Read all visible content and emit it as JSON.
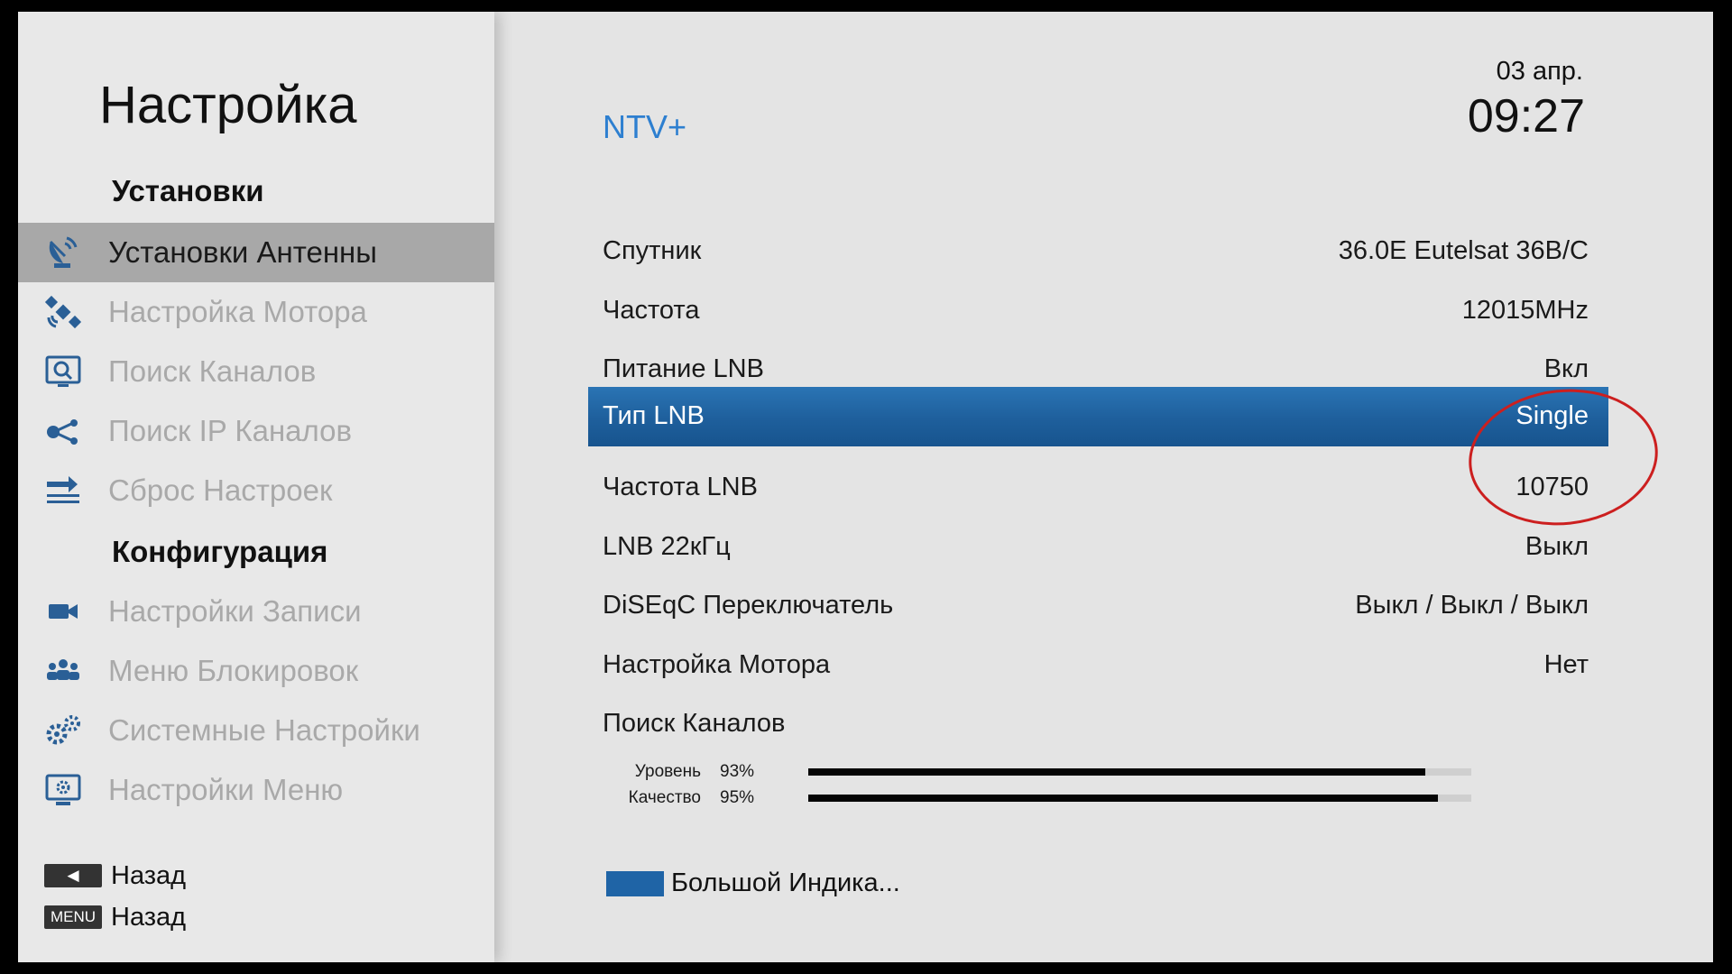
{
  "sidebar": {
    "title": "Настройка",
    "sections": [
      {
        "heading": "Установки",
        "items": [
          {
            "label": "Установки Антенны",
            "icon": "satellite-dish-icon",
            "active": true
          },
          {
            "label": "Настройка Мотора",
            "icon": "satellite-icon",
            "active": false
          },
          {
            "label": "Поиск Каналов",
            "icon": "channel-search-icon",
            "active": false
          },
          {
            "label": "Поиск IP Каналов",
            "icon": "network-icon",
            "active": false
          },
          {
            "label": "Сброс Настроек",
            "icon": "reset-icon",
            "active": false
          }
        ]
      },
      {
        "heading": "Конфигурация",
        "items": [
          {
            "label": "Настройки Записи",
            "icon": "video-camera-icon",
            "active": false
          },
          {
            "label": "Меню Блокировок",
            "icon": "people-icon",
            "active": false
          },
          {
            "label": "Системные Настройки",
            "icon": "gears-icon",
            "active": false
          },
          {
            "label": "Настройки Меню",
            "icon": "monitor-settings-icon",
            "active": false
          }
        ]
      }
    ],
    "hints": [
      {
        "key": "◀",
        "label": "Назад"
      },
      {
        "key": "MENU",
        "label": "Назад"
      }
    ]
  },
  "main": {
    "title": "NTV+",
    "date": "03 апр.",
    "time": "09:27",
    "settings": [
      {
        "label": "Спутник",
        "value": "36.0E Eutelsat 36B/C",
        "selected": false
      },
      {
        "label": "Частота",
        "value": "12015MHz",
        "selected": false
      },
      {
        "label": "Питание LNB",
        "value": "Вкл",
        "selected": false
      },
      {
        "label": "Тип LNB",
        "value": "Single",
        "selected": true
      },
      {
        "label": "Частота LNB",
        "value": "10750",
        "selected": false
      },
      {
        "label": "LNB 22кГц",
        "value": "Выкл",
        "selected": false
      },
      {
        "label": "DiSEqC Переключатель",
        "value": "Выкл / Выкл / Выкл",
        "selected": false
      },
      {
        "label": "Настройка Мотора",
        "value": "Нет",
        "selected": false
      },
      {
        "label": "Поиск Каналов",
        "value": "",
        "selected": false
      }
    ],
    "signal": {
      "level": {
        "label": "Уровень",
        "percent_text": "93%",
        "percent": 93
      },
      "quality": {
        "label": "Качество",
        "percent_text": "95%",
        "percent": 95
      }
    },
    "big_indicator": {
      "label": "Большой Индика...",
      "color": "#1f64a6"
    }
  },
  "colors": {
    "accent": "#2d7fd0",
    "selection": "#1e5f9c",
    "annotation": "#cc1f1f",
    "sidebar_active": "#a8a8a8",
    "disabled_text": "#a9a9a9"
  }
}
